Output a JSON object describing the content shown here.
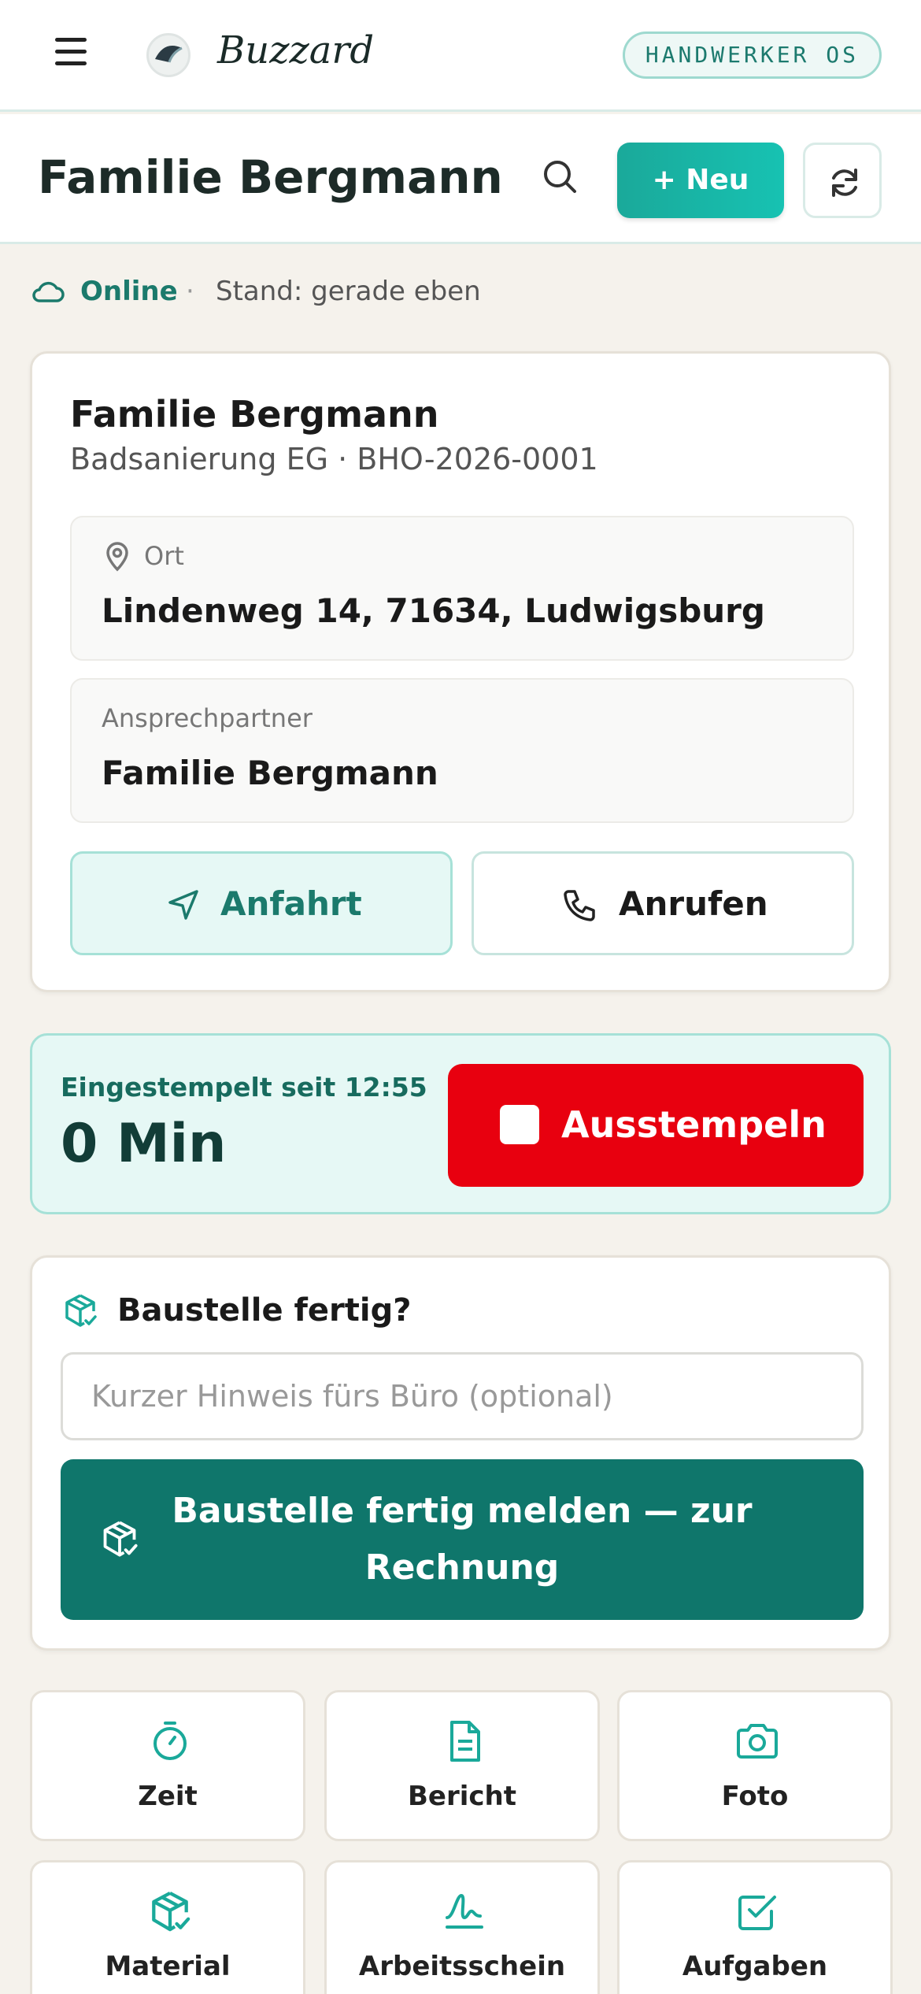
{
  "app": {
    "brand": "Buzzard",
    "role_badge": "HANDWERKER OS"
  },
  "header": {
    "title": "Familie Bergmann",
    "new_label": "+ Neu"
  },
  "status": {
    "online_label": "Online",
    "separator": "·",
    "stand_text": "Stand: gerade eben"
  },
  "project": {
    "name": "Familie Bergmann",
    "subtitle": "Badsanierung EG · BHO-2026-0001",
    "location_label": "Ort",
    "location_value": "Lindenweg 14, 71634, Ludwigsburg",
    "contact_label": "Ansprechpartner",
    "contact_value": "Familie Bergmann",
    "route_label": "Anfahrt",
    "call_label": "Anrufen"
  },
  "clock": {
    "since_text": "Eingestempelt seit 12:55",
    "duration": "0 Min",
    "stamp_out_label": "Ausstempeln"
  },
  "done": {
    "title": "Baustelle fertig?",
    "note_placeholder": "Kurzer Hinweis fürs Büro (optional)",
    "note_value": "",
    "submit_label": "Baustelle fertig melden — zur Rechnung"
  },
  "tiles": [
    {
      "label": "Zeit",
      "icon": "timer-icon"
    },
    {
      "label": "Bericht",
      "icon": "document-icon"
    },
    {
      "label": "Foto",
      "icon": "camera-icon"
    },
    {
      "label": "Material",
      "icon": "package-icon"
    },
    {
      "label": "Arbeitsschein",
      "icon": "signature-icon"
    },
    {
      "label": "Aufgaben",
      "icon": "checkbox-icon"
    }
  ],
  "colors": {
    "accent": "#1aa99a",
    "accent_dark": "#0f766b",
    "danger": "#e8000f",
    "background": "#f5f2ec"
  }
}
